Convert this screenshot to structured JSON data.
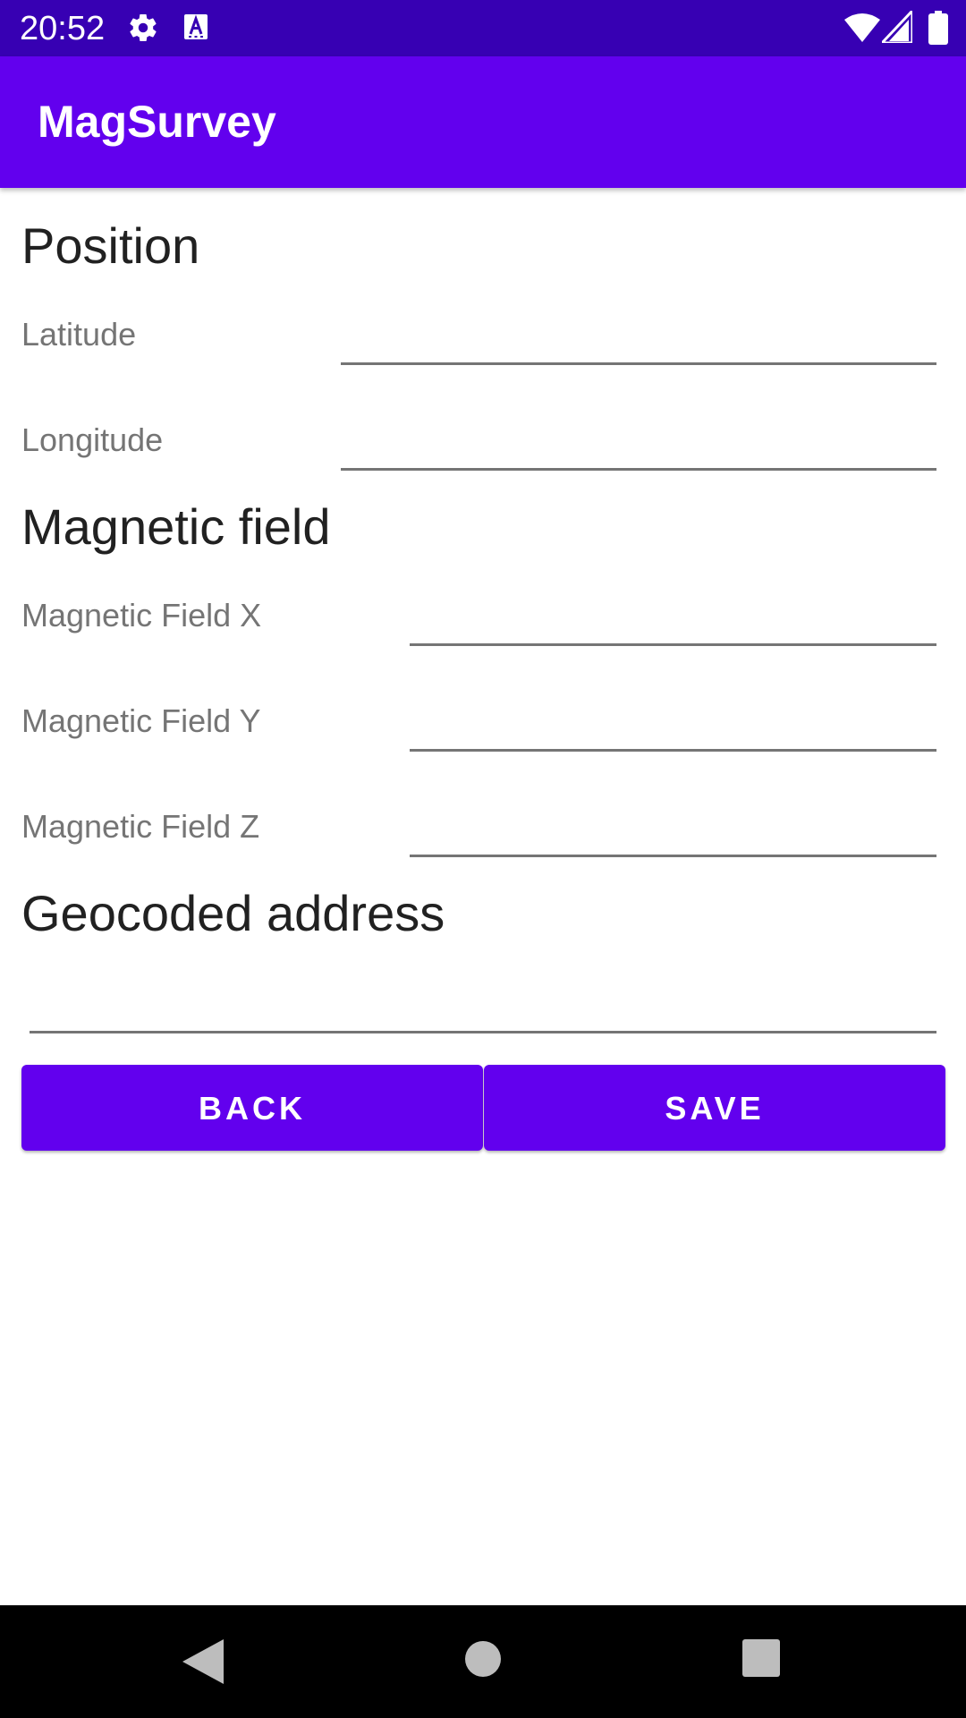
{
  "status_bar": {
    "time": "20:52",
    "icons": [
      "gear-icon",
      "keyboard-a-icon",
      "wifi-icon",
      "signal-icon",
      "battery-icon"
    ],
    "background": "#3700b3"
  },
  "app_bar": {
    "title": "MagSurvey",
    "background": "#6200ee"
  },
  "position": {
    "heading": "Position",
    "latitude": {
      "label": "Latitude",
      "value": ""
    },
    "longitude": {
      "label": "Longitude",
      "value": ""
    }
  },
  "magnetic": {
    "heading": "Magnetic field",
    "x": {
      "label": "Magnetic Field X",
      "value": ""
    },
    "y": {
      "label": "Magnetic Field Y",
      "value": ""
    },
    "z": {
      "label": "Magnetic Field Z",
      "value": ""
    }
  },
  "address": {
    "heading": "Geocoded address",
    "value": ""
  },
  "buttons": {
    "back_label": "BACK",
    "save_label": "SAVE",
    "color": "#6200ee"
  },
  "nav_bar": {
    "icons": [
      "back-triangle-icon",
      "home-circle-icon",
      "recents-square-icon"
    ]
  }
}
